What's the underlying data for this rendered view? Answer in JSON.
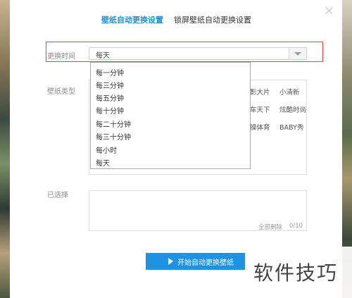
{
  "tabs": {
    "wallpaper": "壁纸自动更换设置",
    "lockscreen": "锁屏壁纸自动更换设置"
  },
  "change_time": {
    "label": "更换时间",
    "selected_value": "每天",
    "options": [
      "每一分钟",
      "每三分钟",
      "每五分钟",
      "每十分钟",
      "每二十分钟",
      "每三十分钟",
      "每小时",
      "每天"
    ]
  },
  "wallpaper_type": {
    "label": "壁纸类型",
    "visible_categories": [
      "影大片",
      "小清新",
      "车天下",
      "炫酷时尚",
      "操体育",
      "BABY秀"
    ]
  },
  "selected": {
    "label": "已选择",
    "clear_all": "全部删除",
    "count": "0/10"
  },
  "start_button": "开始自动更换壁纸",
  "watermark": "软件技巧",
  "colors": {
    "accent": "#1f8fd6",
    "button": "#1f93e3",
    "highlight": "#e04646"
  }
}
